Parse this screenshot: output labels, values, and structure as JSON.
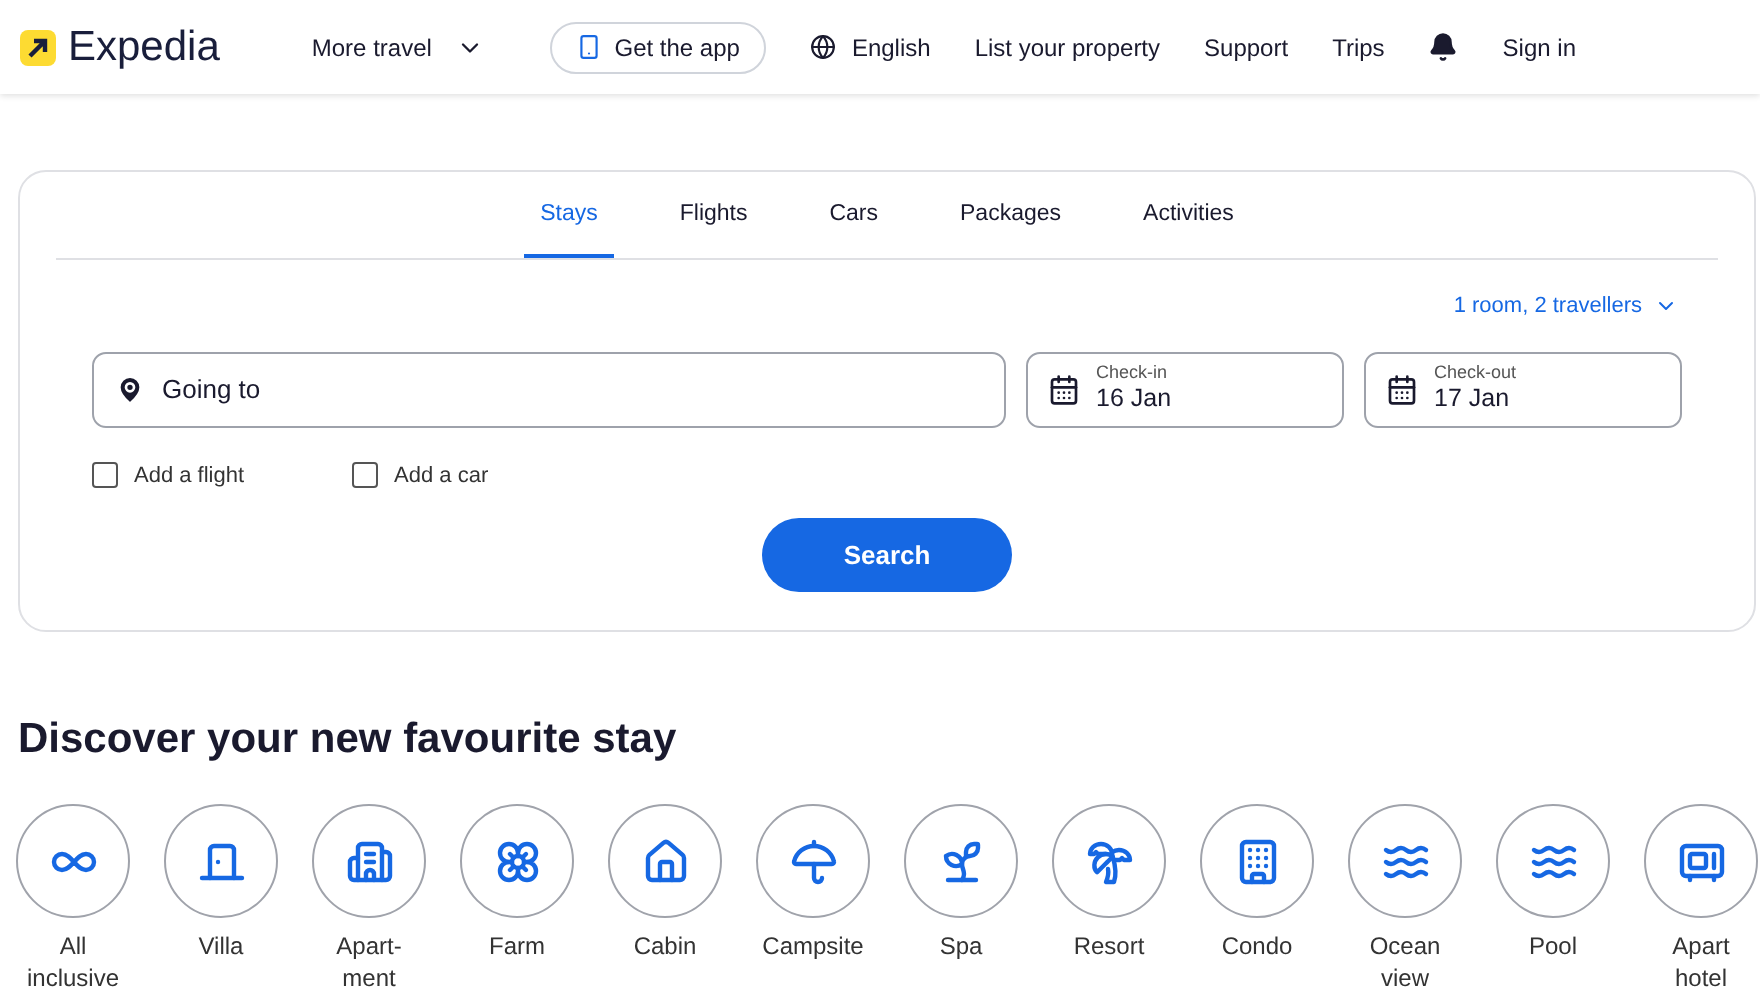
{
  "header": {
    "logo": "Expedia",
    "nav": [
      {
        "kind": "menu",
        "label": "More travel"
      },
      {
        "kind": "app",
        "label": "Get the app"
      },
      {
        "kind": "language",
        "label": "English"
      },
      {
        "kind": "link",
        "label": "List your property"
      },
      {
        "kind": "link",
        "label": "Support"
      },
      {
        "kind": "link",
        "label": "Trips"
      },
      {
        "kind": "bell"
      },
      {
        "kind": "link",
        "label": "Sign in"
      }
    ]
  },
  "search": {
    "tabs": [
      {
        "label": "Stays",
        "selected": true
      },
      {
        "label": "Flights",
        "selected": false
      },
      {
        "label": "Cars",
        "selected": false
      },
      {
        "label": "Packages",
        "selected": false
      },
      {
        "label": "Activities",
        "selected": false
      }
    ],
    "travellers": "1 room, 2 travellers",
    "destination": {
      "placeholder": "Going to"
    },
    "check_in": {
      "label": "Check-in",
      "value": "16 Jan"
    },
    "check_out": {
      "label": "Check-out",
      "value": "17 Jan"
    },
    "options": [
      {
        "label": "Add a flight",
        "checked": false
      },
      {
        "label": "Add a car",
        "checked": false
      }
    ],
    "button": "Search"
  },
  "discover": {
    "title": "Discover your new favourite stay",
    "items": [
      {
        "label": "All inclusive"
      },
      {
        "label": "Villa"
      },
      {
        "label": "Apart- ment"
      },
      {
        "label": "Farm"
      },
      {
        "label": "Cabin"
      },
      {
        "label": "Campsite"
      },
      {
        "label": "Spa"
      },
      {
        "label": "Resort"
      },
      {
        "label": "Condo"
      },
      {
        "label": "Ocean view"
      },
      {
        "label": "Pool"
      },
      {
        "label": "Apart hotel"
      }
    ]
  }
}
